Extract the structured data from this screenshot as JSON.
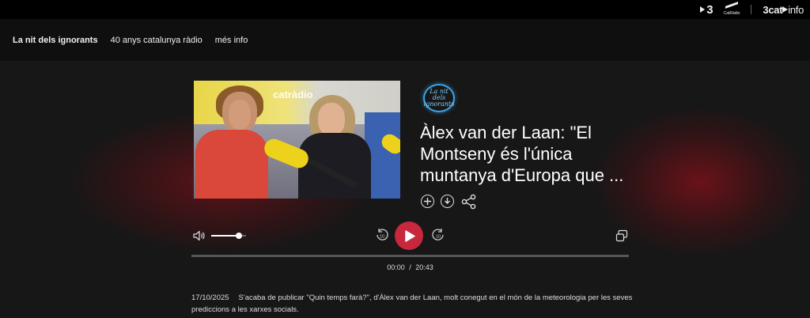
{
  "header": {
    "brand_3": "3",
    "brand_cr": "CatRàdio",
    "brand_info_a": "3cat",
    "brand_info_b": "info"
  },
  "nav": {
    "items": [
      {
        "label": "La nit dels ignorants",
        "active": true
      },
      {
        "label": "40 anys catalunya ràdio",
        "active": false
      },
      {
        "label": "més info",
        "active": false
      }
    ]
  },
  "episode": {
    "show_logo_line1": "La nit dels",
    "show_logo_line2": "ignorants",
    "title": "Àlex van der Laan: \"El Montseny és l'única muntanya d'Europa que ...",
    "photo_sign": "catràdio",
    "actions": {
      "add_icon": "plus-circle-icon",
      "download_icon": "download-icon",
      "share_icon": "share-icon"
    }
  },
  "player": {
    "volume_level": 0.8,
    "rewind_label": "10",
    "forward_label": "10",
    "progress": 0.0,
    "current_time": "00:00",
    "separator": "/",
    "duration": "20:43",
    "accent": "#c7283d"
  },
  "description": {
    "date": "17/10/2025",
    "text": "S'acaba de publicar \"Quin temps farà?\", d'Àlex van der Laan, molt conegut en el món de la meteorologia per les seves prediccions a les xarxes socials."
  }
}
